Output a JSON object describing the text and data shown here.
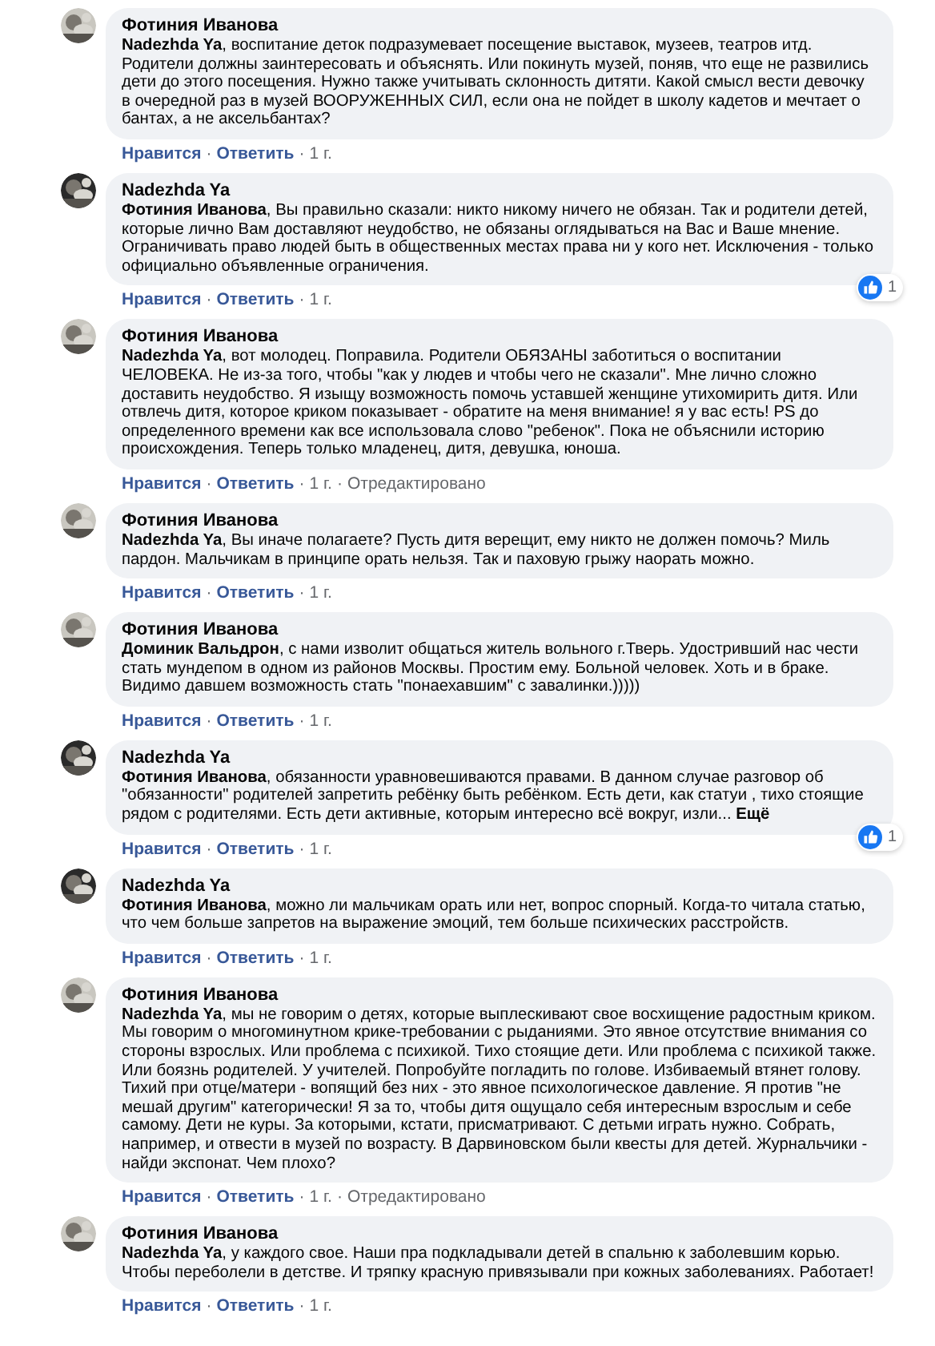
{
  "separator": "·",
  "comments": [
    {
      "author": "Фотиния Иванова",
      "text": "**Nadezhda Ya**, воспитание деток подразумевает посещение выставок, музеев, театров итд. Родители должны заинтересовать и объяснять. Или покинуть музей, поняв, что еще не развились дети до этого посещения. Нужно также учитывать склонность дитяти. Какой смысл вести девочку в очередной раз в музей ВООРУЖЕННЫХ СИЛ, если она не пойдет в школу кадетов и мечтает о бантах, а не аксельбантах?",
      "like": "Нравится",
      "reply": "Ответить",
      "time": "1 г."
    },
    {
      "author": "Nadezhda Ya",
      "text": "**Фотиния Иванова**, Вы правильно сказали: никто никому ничего не обязан. Так и родители детей, которые лично Вам доставляют неудобство, не обязаны оглядываться на Вас и Ваше мнение. Ограничивать право людей быть в общественных местах права ни у кого нет. Исключения - только официально объявленные ограничения.",
      "like": "Нравится",
      "reply": "Ответить",
      "time": "1 г.",
      "reactions": "1"
    },
    {
      "author": "Фотиния Иванова",
      "text": "**Nadezhda Ya**, вот молодец. Поправила. Родители ОБЯЗАНЫ заботиться о воспитании ЧЕЛОВЕКА. Не из-за того, чтобы \"как у людев и чтобы чего не сказали\". Мне лично сложно доставить неудобство. Я изыщу возможность помочь уставшей женщине утихомирить дитя. Или отвлечь дитя, которое криком показывает - обратите на меня внимание! я у вас есть! PS до определенного времени как все использовала слово \"ребенок\". Пока не объяснили историю происхождения. Теперь только младенец, дитя, девушка, юноша.",
      "like": "Нравится",
      "reply": "Ответить",
      "time": "1 г.",
      "edited": "Отредактировано"
    },
    {
      "author": "Фотиния Иванова",
      "text": "**Nadezhda Ya**, Вы иначе полагаете? Пусть дитя верещит, ему никто не должен помочь? Миль пардон. Мальчикам в принципе орать нельзя. Так и паховую грыжу наорать можно.",
      "like": "Нравится",
      "reply": "Ответить",
      "time": "1 г."
    },
    {
      "author": "Фотиния Иванова",
      "text": "**Доминик Вальдрон**, с нами изволит общаться житель вольного г.Тверь. Удостривший нас чести стать мундепом в одном из районов Москвы. Простим ему. Больной человек. Хоть и в браке. Видимо давшем возможность стать \"понаехавшим\" с завалинки.)))))",
      "like": "Нравится",
      "reply": "Ответить",
      "time": "1 г."
    },
    {
      "author": "Nadezhda Ya",
      "text": "**Фотиния Иванова**, обязанности уравновешиваются правами. В данном случае разговор об \"обязанности\" родителей запретить ребёнку быть ребёнком. Есть дети, как статуи , тихо стоящие рядом с родителями. Есть дети активные, которым интересно всё вокруг, изли...",
      "more": "Ещё",
      "like": "Нравится",
      "reply": "Ответить",
      "time": "1 г.",
      "reactions": "1"
    },
    {
      "author": "Nadezhda Ya",
      "text": "**Фотиния Иванова**, можно ли мальчикам орать или нет, вопрос спорный. Когда-то читала статью, что чем больше запретов на выражение эмоций, тем больше психических расстройств.",
      "like": "Нравится",
      "reply": "Ответить",
      "time": "1 г."
    },
    {
      "author": "Фотиния Иванова",
      "text": "**Nadezhda Ya**, мы не говорим о детях, которые выплескивают свое восхищение радостным криком. Мы говорим о многоминутном крике-требовании с рыданиями. Это явное отсутствие внимания со стороны взрослых. Или проблема с психикой. Тихо стоящие дети. Или проблема с психикой также. Или боязнь родителей. У учителей. Попробуйте погладить по голове. Избиваемый втянет голову. Тихий при отце/матери - вопящий без них - это явное психологическое давление. Я против \"не мешай другим\" категорически! Я за то, чтобы дитя ощущало себя интересным взрослым и себе самому. Дети не куры. За которыми, кстати, присматривают. С детьми играть нужно. Собрать, например, и отвести в музей по возрасту. В Дарвиновском были квесты для детей. Журнальчики - найди экспонат. Чем плохо?",
      "like": "Нравится",
      "reply": "Ответить",
      "time": "1 г.",
      "edited": "Отредактировано"
    },
    {
      "author": "Фотиния Иванова",
      "text": "**Nadezhda Ya**, у каждого свое. Наши пра подкладывали детей в спальню к заболевшим корью. Чтобы переболели в детстве. И тряпку красную привязывали при кожных заболеваниях. Работает!",
      "like": "Нравится",
      "reply": "Ответить",
      "time": "1 г."
    }
  ]
}
